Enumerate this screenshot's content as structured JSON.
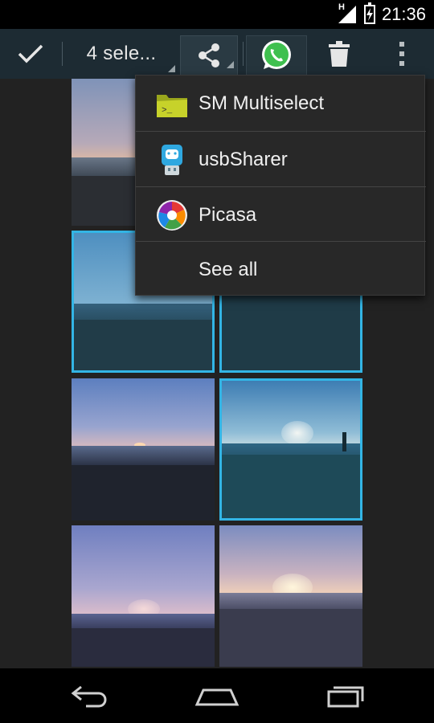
{
  "status_bar": {
    "time": "21:36",
    "network_type": "H",
    "icons": [
      "signal-icon",
      "battery-charging-icon"
    ]
  },
  "action_bar": {
    "selection_label": "4 sele...",
    "icons": [
      "done-check-icon",
      "share-icon",
      "whatsapp-icon",
      "delete-trash-icon",
      "overflow-menu-icon"
    ],
    "accent_color": "#33b5e5"
  },
  "share_menu": {
    "items": [
      {
        "label": "SM Multiselect",
        "icon": "folder-app-icon"
      },
      {
        "label": "usbSharer",
        "icon": "usb-android-icon"
      },
      {
        "label": "Picasa",
        "icon": "picasa-icon"
      },
      {
        "label": "See all",
        "icon": ""
      }
    ]
  },
  "gallery": {
    "photos": [
      {
        "state": "unselected",
        "subject": "beach sunset"
      },
      {
        "state": "selected",
        "subject": "beach sunset"
      },
      {
        "state": "selected",
        "subject": "beach sunset"
      },
      {
        "state": "unselected",
        "subject": "beach sunset"
      },
      {
        "state": "selected",
        "subject": "beach sunset"
      },
      {
        "state": "unselected",
        "subject": "beach sunset"
      },
      {
        "state": "unselected",
        "subject": "beach sunset"
      }
    ]
  },
  "nav_bar": {
    "icons": [
      "back-icon",
      "home-icon",
      "recent-apps-icon"
    ]
  }
}
